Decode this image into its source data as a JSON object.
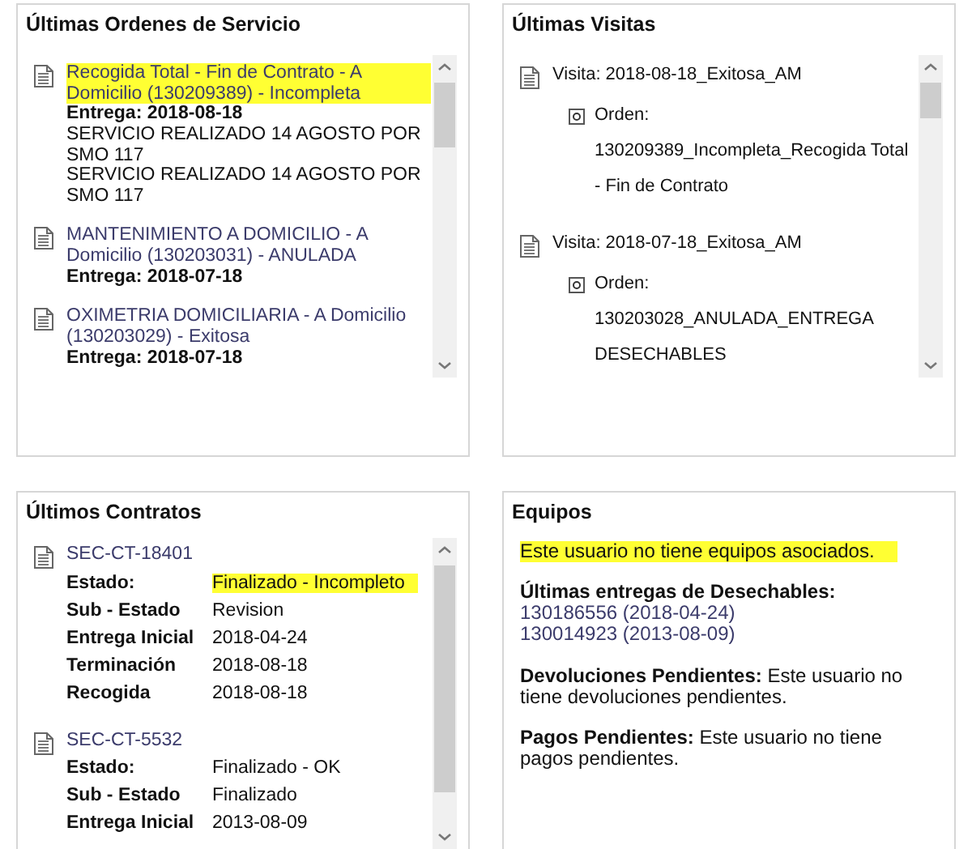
{
  "orders_panel": {
    "title": "Últimas Ordenes de Servicio",
    "items": [
      {
        "title": "Recogida Total - Fin de Contrato - A Domicilio (130209389) - Incompleta",
        "highlighted": true,
        "entrega": "Entrega: 2018-08-18",
        "notes": [
          "SERVICIO REALIZADO 14 AGOSTO POR SMO 117",
          "SERVICIO REALIZADO 14 AGOSTO POR SMO 117"
        ]
      },
      {
        "title": "MANTENIMIENTO A DOMICILIO - A Domicilio (130203031) - ANULADA",
        "highlighted": false,
        "entrega": "Entrega: 2018-07-18"
      },
      {
        "title": "OXIMETRIA DOMICILIARIA - A Domicilio (130203029) - Exitosa",
        "highlighted": false,
        "entrega": "Entrega: 2018-07-18"
      }
    ]
  },
  "visits_panel": {
    "title": "Últimas Visitas",
    "items": [
      {
        "title": "Visita: 2018-08-18_Exitosa_AM",
        "orders": [
          "Orden: 130209389_Incompleta_Recogida Total - Fin de Contrato"
        ]
      },
      {
        "title": "Visita: 2018-07-18_Exitosa_AM",
        "orders": [
          "Orden: 130203028_ANULADA_ENTREGA DESECHABLES"
        ]
      }
    ]
  },
  "contracts_panel": {
    "title": "Últimos Contratos",
    "items": [
      {
        "code": "SEC-CT-18401",
        "fields": [
          {
            "label": "Estado:",
            "value": "Finalizado - Incompleto",
            "highlighted": true
          },
          {
            "label": "Sub - Estado",
            "value": "Revision",
            "highlighted": false
          },
          {
            "label": "Entrega Inicial",
            "value": "2018-04-24",
            "highlighted": false
          },
          {
            "label": "Terminación",
            "value": "2018-08-18",
            "highlighted": false
          },
          {
            "label": "Recogida",
            "value": "2018-08-18",
            "highlighted": false
          }
        ]
      },
      {
        "code": "SEC-CT-5532",
        "fields": [
          {
            "label": "Estado:",
            "value": "Finalizado - OK",
            "highlighted": false
          },
          {
            "label": "Sub - Estado",
            "value": "Finalizado",
            "highlighted": false
          },
          {
            "label": "Entrega Inicial",
            "value": "2013-08-09",
            "highlighted": false
          }
        ]
      }
    ]
  },
  "equipment_panel": {
    "title": "Equipos",
    "message": "Este usuario no tiene equipos asociados.",
    "message_highlighted": true,
    "disposables_heading": "Últimas entregas de Desechables:",
    "disposables": [
      "130186556 (2018-04-24)",
      "130014923 (2013-08-09)"
    ],
    "notes": [
      {
        "label": "Devoluciones Pendientes:",
        "text": "Este usuario no tiene devoluciones pendientes."
      },
      {
        "label": "Pagos Pendientes:",
        "text": "Este usuario no tiene pagos pendientes."
      }
    ]
  }
}
